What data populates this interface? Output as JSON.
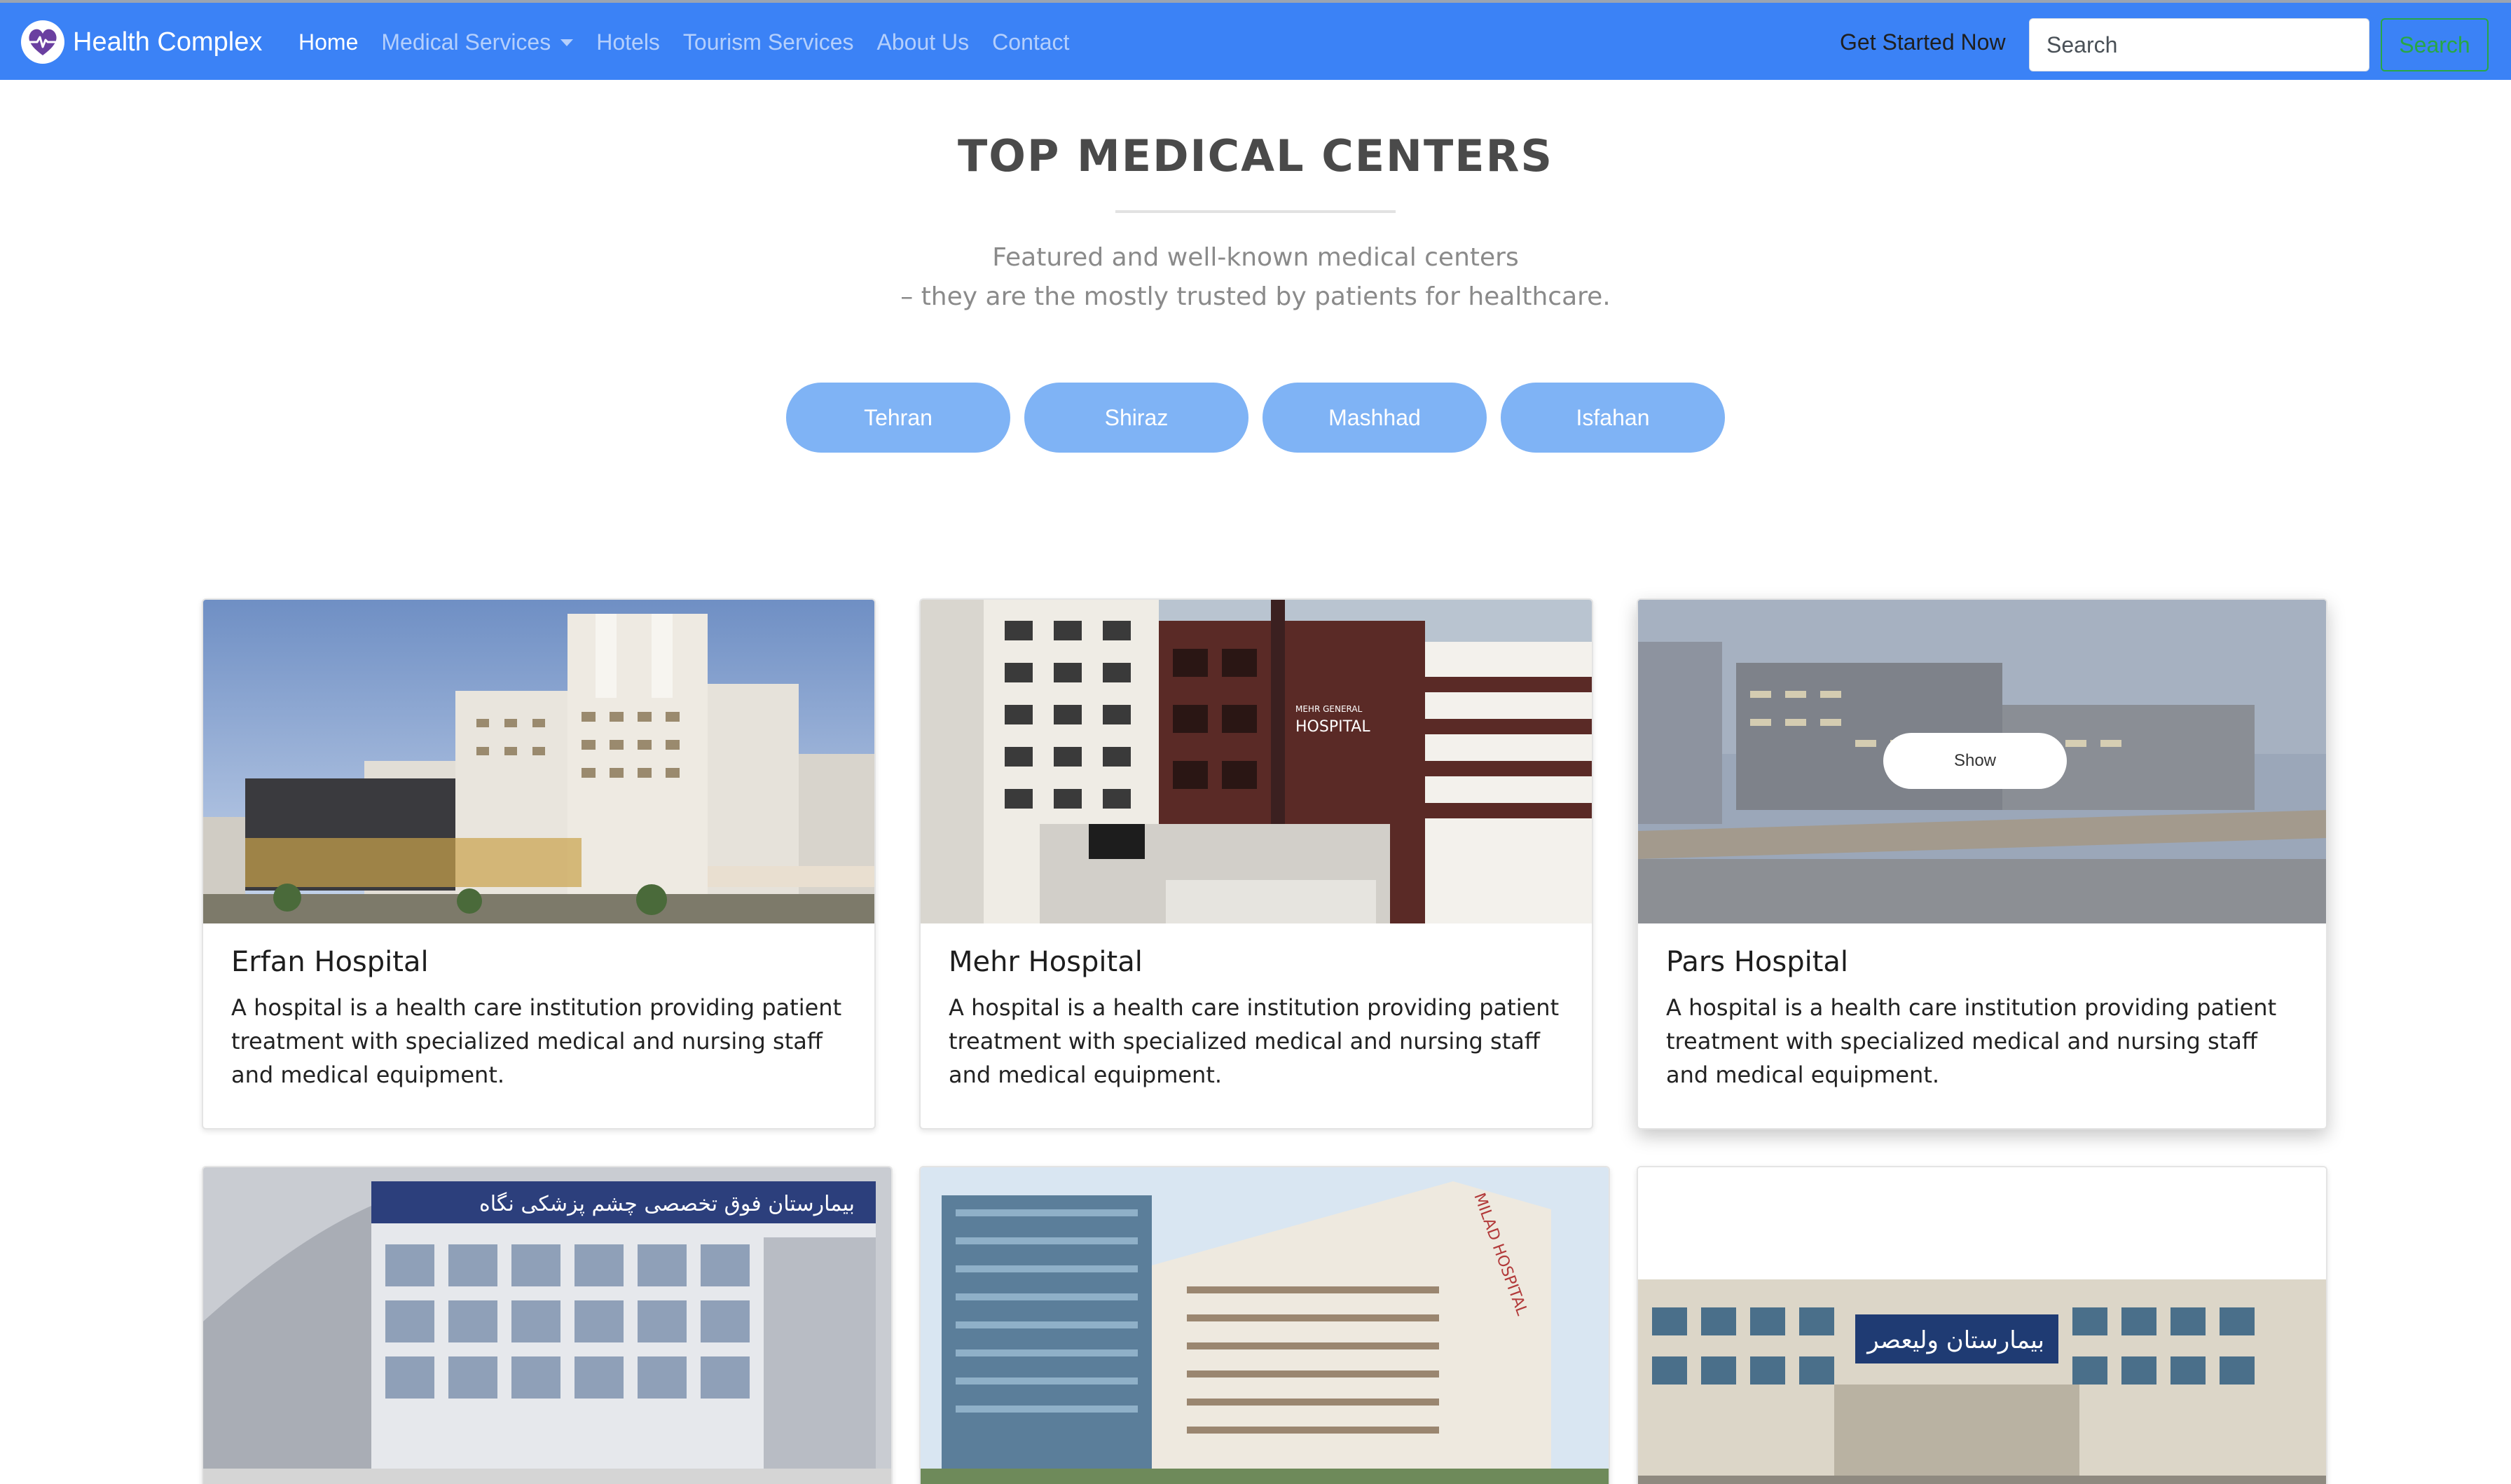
{
  "navbar": {
    "brand": "Health Complex",
    "brand_icon": "heart-pulse-icon",
    "links": [
      {
        "label": "Home",
        "active": true
      },
      {
        "label": "Medical Services",
        "dropdown": true
      },
      {
        "label": "Hotels"
      },
      {
        "label": "Tourism Services"
      },
      {
        "label": "About Us"
      },
      {
        "label": "Contact"
      }
    ],
    "get_started": "Get Started Now",
    "search_placeholder": "Search",
    "search_button": "Search",
    "colors": {
      "bar": "#3b82f6",
      "search_button": "#28a745"
    }
  },
  "section": {
    "title": "TOP MEDICAL CENTERS",
    "subtitle_line1": "Featured and well-known medical centers",
    "subtitle_line2": "– they are the mostly trusted by patients for healthcare."
  },
  "cities": [
    "Tehran",
    "Shiraz",
    "Mashhad",
    "Isfahan"
  ],
  "cards": [
    {
      "title": "Erfan Hospital",
      "text": "A hospital is a health care institution providing patient treatment with specialized medical and nursing staff and medical equipment."
    },
    {
      "title": "Mehr Hospital",
      "text": "A hospital is a health care institution providing patient treatment with specialized medical and nursing staff and medical equipment.",
      "sign": "MEHR GENERAL HOSPITAL"
    },
    {
      "title": "Pars Hospital",
      "text": "A hospital is a health care institution providing patient treatment with specialized medical and nursing staff and medical equipment.",
      "show_button": "Show"
    },
    {
      "sign": "بیمارستان فوق تخصصی چشم پزشکی نگاه"
    },
    {
      "sign": "MILAD HOSPITAL"
    },
    {
      "sign": "بیمارستان ولیعصر"
    }
  ]
}
